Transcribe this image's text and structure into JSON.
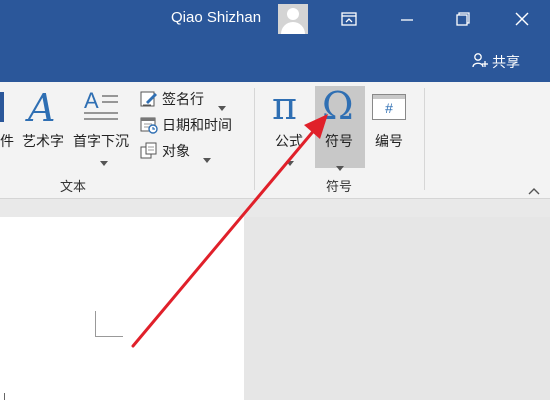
{
  "titlebar": {
    "user_name": "Qiao Shizhan",
    "share_label": "共享",
    "bg_color": "#2b579a"
  },
  "icons": {
    "avatar": "user-avatar-icon",
    "ribbon_display": "ribbon-display-options-icon",
    "minimize": "minimize-icon",
    "restore": "restore-icon",
    "close": "close-icon",
    "share": "share-person-icon"
  },
  "ribbon": {
    "text_group": {
      "label": "文本",
      "partial_item": "件",
      "wordart": "艺术字",
      "dropcap": "首字下沉",
      "signature_line": "签名行",
      "date_time": "日期和时间",
      "object": "对象"
    },
    "symbols_group": {
      "label": "符号",
      "equation": "公式",
      "symbol": "符号",
      "numbering": "编号",
      "equation_glyph": "π",
      "symbol_glyph": "Ω",
      "numbering_glyph": "#"
    }
  },
  "annotation": {
    "arrow_color": "#e0202a"
  }
}
